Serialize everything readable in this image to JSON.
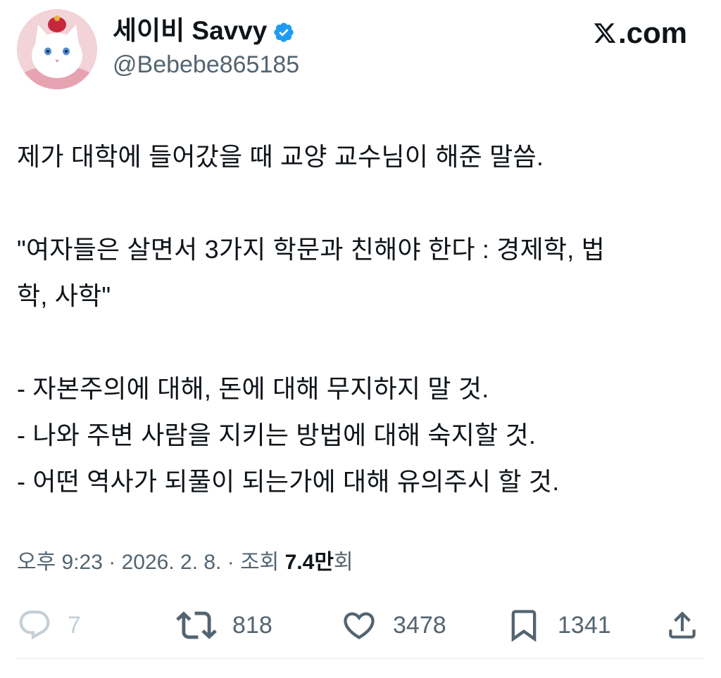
{
  "user": {
    "display_name": "세이비 Savvy",
    "handle": "@Bebebe865185",
    "verified": true,
    "avatar_icon": "cat-avatar-icon"
  },
  "brand": {
    "label": ".com"
  },
  "tweet": {
    "lines": [
      "제가 대학에 들어갔을 때 교양 교수님이 해준 말씀.",
      "",
      "\"여자들은 살면서 3가지 학문과 친해야 한다 : 경제학, 법",
      "학, 사학\"",
      "",
      "- 자본주의에 대해, 돈에 대해 무지하지 말 것.",
      "- 나와 주변 사람을 지키는 방법에 대해 숙지할 것.",
      "- 어떤 역사가 되풀이 되는가에 대해 유의주시 할 것."
    ]
  },
  "meta": {
    "time": "오후 9:23",
    "separator1": " · ",
    "date": "2026. 2. 8.",
    "separator2": " · ",
    "views_label": "조회 ",
    "views_count": "7.4만",
    "views_suffix": "회"
  },
  "actions": {
    "reply_count": "7",
    "retweet_count": "818",
    "like_count": "3478",
    "bookmark_count": "1341"
  },
  "colors": {
    "text": "#0f1419",
    "secondary": "#536471",
    "verified_blue": "#1d9bf0",
    "muted_icon": "#c4cfd6"
  }
}
